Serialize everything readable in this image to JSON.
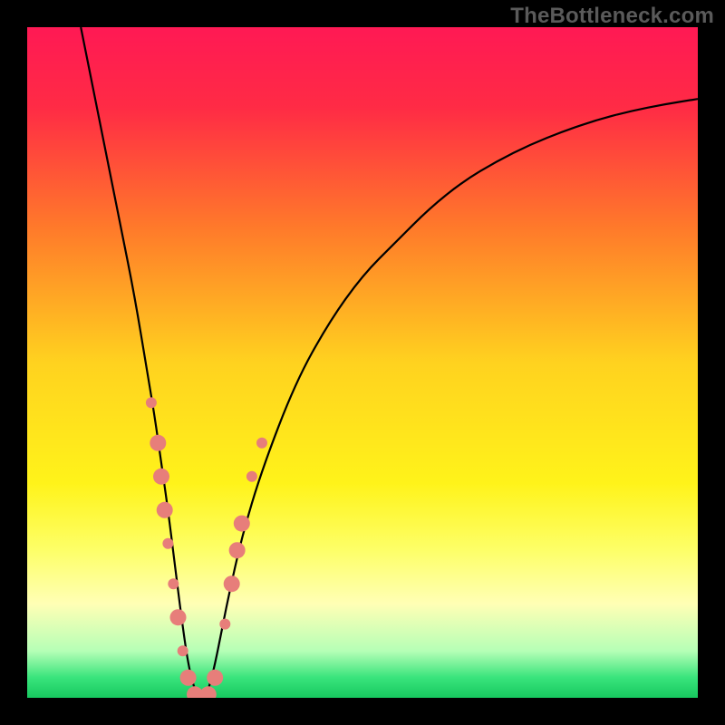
{
  "watermark": "TheBottleneck.com",
  "chart_data": {
    "type": "line",
    "title": "",
    "xlabel": "",
    "ylabel": "",
    "xlim": [
      0,
      100
    ],
    "ylim": [
      0,
      100
    ],
    "background_gradient": {
      "stops": [
        {
          "offset": 0.0,
          "color": "#ff1954"
        },
        {
          "offset": 0.12,
          "color": "#ff2b45"
        },
        {
          "offset": 0.3,
          "color": "#ff7a2a"
        },
        {
          "offset": 0.5,
          "color": "#ffd21f"
        },
        {
          "offset": 0.68,
          "color": "#fff31a"
        },
        {
          "offset": 0.78,
          "color": "#fdff68"
        },
        {
          "offset": 0.86,
          "color": "#ffffb5"
        },
        {
          "offset": 0.93,
          "color": "#b6ffb6"
        },
        {
          "offset": 0.97,
          "color": "#39e47c"
        },
        {
          "offset": 1.0,
          "color": "#17c85f"
        }
      ]
    },
    "series": [
      {
        "name": "bottleneck-curve",
        "color": "#000000",
        "x": [
          8,
          10,
          12,
          14,
          16,
          18,
          19,
          20,
          21,
          22,
          23,
          24,
          25,
          26,
          27,
          28,
          29,
          30,
          32,
          35,
          40,
          45,
          50,
          55,
          60,
          65,
          70,
          75,
          80,
          85,
          90,
          95,
          100
        ],
        "y": [
          100,
          90,
          80,
          70,
          60,
          48,
          42,
          35,
          28,
          20,
          12,
          5,
          1,
          0,
          1,
          5,
          10,
          15,
          24,
          34,
          47,
          56,
          63,
          68,
          73,
          77,
          80,
          82.5,
          84.5,
          86.2,
          87.5,
          88.5,
          89.3
        ]
      }
    ],
    "markers": {
      "color": "#e77e7a",
      "radius_small": 6,
      "radius_large": 9,
      "points": [
        {
          "x": 18.5,
          "y": 44,
          "r": "small"
        },
        {
          "x": 19.5,
          "y": 38,
          "r": "large"
        },
        {
          "x": 20.0,
          "y": 33,
          "r": "large"
        },
        {
          "x": 20.5,
          "y": 28,
          "r": "large"
        },
        {
          "x": 21.0,
          "y": 23,
          "r": "small"
        },
        {
          "x": 21.8,
          "y": 17,
          "r": "small"
        },
        {
          "x": 22.5,
          "y": 12,
          "r": "large"
        },
        {
          "x": 23.2,
          "y": 7,
          "r": "small"
        },
        {
          "x": 24.0,
          "y": 3,
          "r": "large"
        },
        {
          "x": 25.0,
          "y": 0.5,
          "r": "large"
        },
        {
          "x": 26.0,
          "y": 0,
          "r": "large"
        },
        {
          "x": 27.0,
          "y": 0.5,
          "r": "large"
        },
        {
          "x": 28.0,
          "y": 3,
          "r": "large"
        },
        {
          "x": 29.5,
          "y": 11,
          "r": "small"
        },
        {
          "x": 30.5,
          "y": 17,
          "r": "large"
        },
        {
          "x": 31.3,
          "y": 22,
          "r": "large"
        },
        {
          "x": 32.0,
          "y": 26,
          "r": "large"
        },
        {
          "x": 33.5,
          "y": 33,
          "r": "small"
        },
        {
          "x": 35.0,
          "y": 38,
          "r": "small"
        }
      ]
    }
  }
}
